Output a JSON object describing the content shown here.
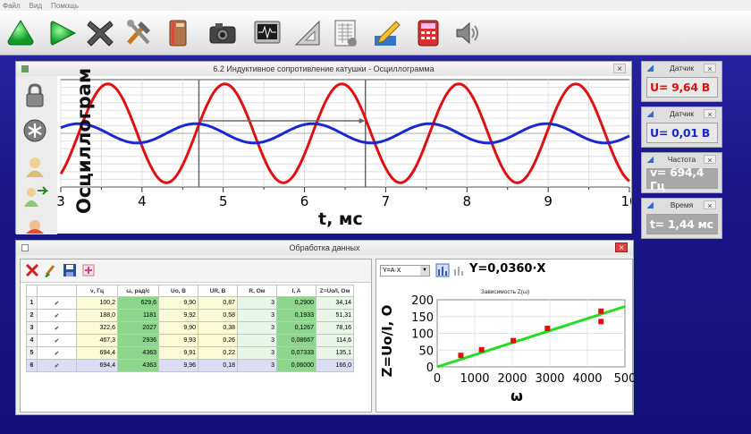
{
  "menu": [
    "Файл",
    "Вид",
    "Помощь"
  ],
  "toolbar": {
    "icons": [
      "green-triangle-up-icon",
      "green-triangle-right-icon",
      "stop-x-icon",
      "tools-icon",
      "book-icon",
      "camera-icon",
      "oscilloscope-icon",
      "triangle-ruler-icon",
      "calculator-sheet-icon",
      "pencil-notepad-icon",
      "red-calculator-icon",
      "speaker-icon"
    ]
  },
  "oscillo_window": {
    "title": "6.2 Индуктивное сопротивление катушки - Осциллограмма",
    "close": "×",
    "ylabel": "Осциллограм",
    "xlabel": "t, мс",
    "xticks": [
      "3",
      "4",
      "5",
      "6",
      "7",
      "8",
      "9",
      "10"
    ]
  },
  "sensors": [
    {
      "title": "Датчик",
      "value": "U= 9,64 В",
      "color": "#e01010"
    },
    {
      "title": "Датчик",
      "value": "U= 0,01 В",
      "color": "#1a28c8"
    },
    {
      "title": "Частота",
      "value": "v= 694,4 Гц",
      "color": "#ffffff"
    },
    {
      "title": "Время",
      "value": "t= 1,44 мс",
      "color": "#ffffff"
    }
  ],
  "data_window": {
    "title": "Обработка данных",
    "close": "×",
    "table": {
      "headers": [
        "",
        "",
        "ν, Гц",
        "ω, рад/с",
        "Uo, В",
        "UR, В",
        "R, Ом",
        "I, A",
        "Z=Uo/I, Ом"
      ],
      "rows": [
        [
          "1",
          "✔",
          "100,2",
          "629,6",
          "9,90",
          "0,87",
          "3",
          "0,2900",
          "34,14"
        ],
        [
          "2",
          "✔",
          "188,0",
          "1181",
          "9,92",
          "0,58",
          "3",
          "0,1933",
          "51,31"
        ],
        [
          "3",
          "✔",
          "322,6",
          "2027",
          "9,90",
          "0,38",
          "3",
          "0,1267",
          "78,16"
        ],
        [
          "4",
          "✔",
          "467,3",
          "2936",
          "9,93",
          "0,26",
          "3",
          "0,08667",
          "114,6"
        ],
        [
          "5",
          "✔",
          "694,4",
          "4363",
          "9,91",
          "0,22",
          "3",
          "0,07333",
          "135,1"
        ],
        [
          "6",
          "✔",
          "694,4",
          "4363",
          "9,96",
          "0,18",
          "3",
          "0,06000",
          "166,0"
        ]
      ]
    },
    "fit_select": "Y=A·X",
    "formula": "Y=0,0360·X",
    "chart_title": "Зависимость Z(ω)",
    "chart_ylabel": "Z=Uo/I, О",
    "chart_xlabel": "ω",
    "chart_xticks": [
      "0",
      "1000",
      "2000",
      "3000",
      "4000",
      "500"
    ],
    "chart_yticks": [
      "0",
      "50",
      "100",
      "150",
      "200"
    ]
  },
  "chart_data": [
    {
      "type": "line",
      "title": "",
      "xlabel": "t, мс",
      "ylabel": "Осциллограм",
      "xlim": [
        3,
        10
      ],
      "grid": true,
      "series": [
        {
          "color": "#e01010",
          "amplitude_rel": 0.92,
          "period_ms": 1.44,
          "phase_ms": 3.58
        },
        {
          "color": "#1a28d0",
          "amplitude_rel": 0.18,
          "period_ms": 1.44,
          "phase_ms": 3.22
        }
      ],
      "cursors_ms": [
        4.7,
        6.75
      ],
      "centerline": true
    },
    {
      "type": "scatter",
      "title": "Зависимость Z(ω)",
      "xlabel": "ω",
      "ylabel": "Z=Uo/I, О",
      "xlim": [
        0,
        5000
      ],
      "ylim": [
        0,
        200
      ],
      "points": [
        [
          629.6,
          34.14
        ],
        [
          1181,
          51.31
        ],
        [
          2027,
          78.16
        ],
        [
          2936,
          114.6
        ],
        [
          4363,
          135.1
        ],
        [
          4363,
          166.0
        ]
      ],
      "fit": {
        "type": "linear",
        "slope": 0.036,
        "color": "#22dd22"
      },
      "point_color": "#e01010"
    }
  ]
}
